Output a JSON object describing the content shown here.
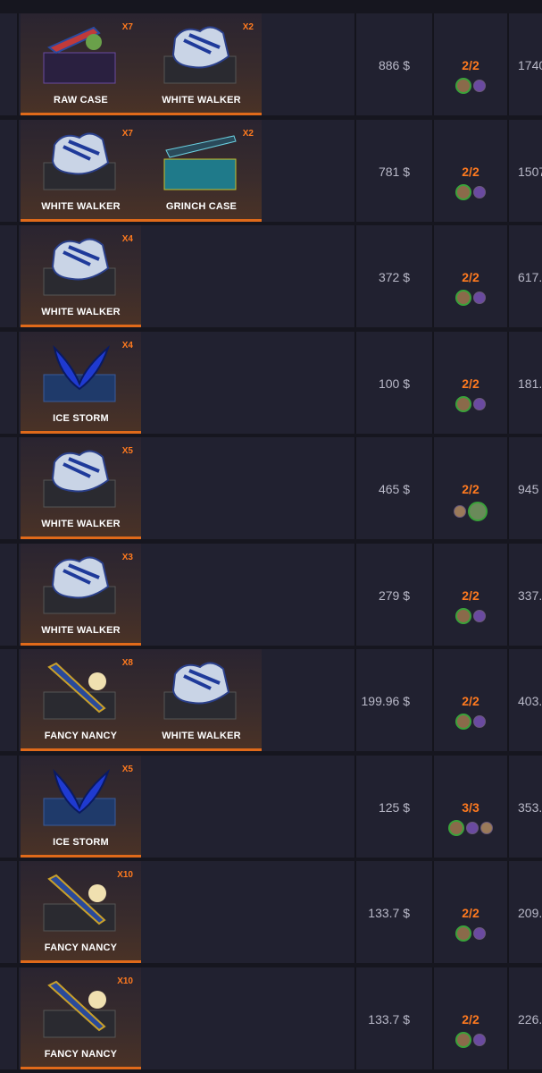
{
  "rows": [
    {
      "cases": [
        {
          "name": "RAW CASE",
          "mult": "X7",
          "icon": "knife-icon"
        },
        {
          "name": "WHITE WALKER",
          "mult": "X2",
          "icon": "gloves-icon"
        }
      ],
      "price": "886 $",
      "players": "2/2",
      "right": "1740"
    },
    {
      "cases": [
        {
          "name": "WHITE WALKER",
          "mult": "X7",
          "icon": "gloves-icon"
        },
        {
          "name": "GRINCH CASE",
          "mult": "X2",
          "icon": "rifle-icon"
        }
      ],
      "price": "781 $",
      "players": "2/2",
      "right": "1507"
    },
    {
      "cases": [
        {
          "name": "WHITE WALKER",
          "mult": "X4",
          "icon": "gloves-icon"
        }
      ],
      "price": "372 $",
      "players": "2/2",
      "right": "617."
    },
    {
      "cases": [
        {
          "name": "ICE STORM",
          "mult": "X4",
          "icon": "butterfly-knife-icon"
        }
      ],
      "price": "100 $",
      "players": "2/2",
      "right": "181."
    },
    {
      "cases": [
        {
          "name": "WHITE WALKER",
          "mult": "X5",
          "icon": "gloves-icon"
        }
      ],
      "price": "465 $",
      "players": "2/2",
      "right": "945"
    },
    {
      "cases": [
        {
          "name": "WHITE WALKER",
          "mult": "X3",
          "icon": "gloves-icon"
        }
      ],
      "price": "279 $",
      "players": "2/2",
      "right": "337."
    },
    {
      "cases": [
        {
          "name": "FANCY NANCY",
          "mult": "X8",
          "icon": "bayonet-icon"
        },
        {
          "name": "WHITE WALKER",
          "mult": "",
          "icon": "gloves-icon"
        }
      ],
      "price": "199.96 $",
      "players": "2/2",
      "right": "403."
    },
    {
      "cases": [
        {
          "name": "ICE STORM",
          "mult": "X5",
          "icon": "butterfly-knife-icon"
        }
      ],
      "price": "125 $",
      "players": "3/3",
      "right": "353."
    },
    {
      "cases": [
        {
          "name": "FANCY NANCY",
          "mult": "X10",
          "icon": "bayonet-icon"
        }
      ],
      "price": "133.7 $",
      "players": "2/2",
      "right": "209."
    },
    {
      "cases": [
        {
          "name": "FANCY NANCY",
          "mult": "X10",
          "icon": "bayonet-icon"
        }
      ],
      "price": "133.7 $",
      "players": "2/2",
      "right": "226."
    }
  ]
}
